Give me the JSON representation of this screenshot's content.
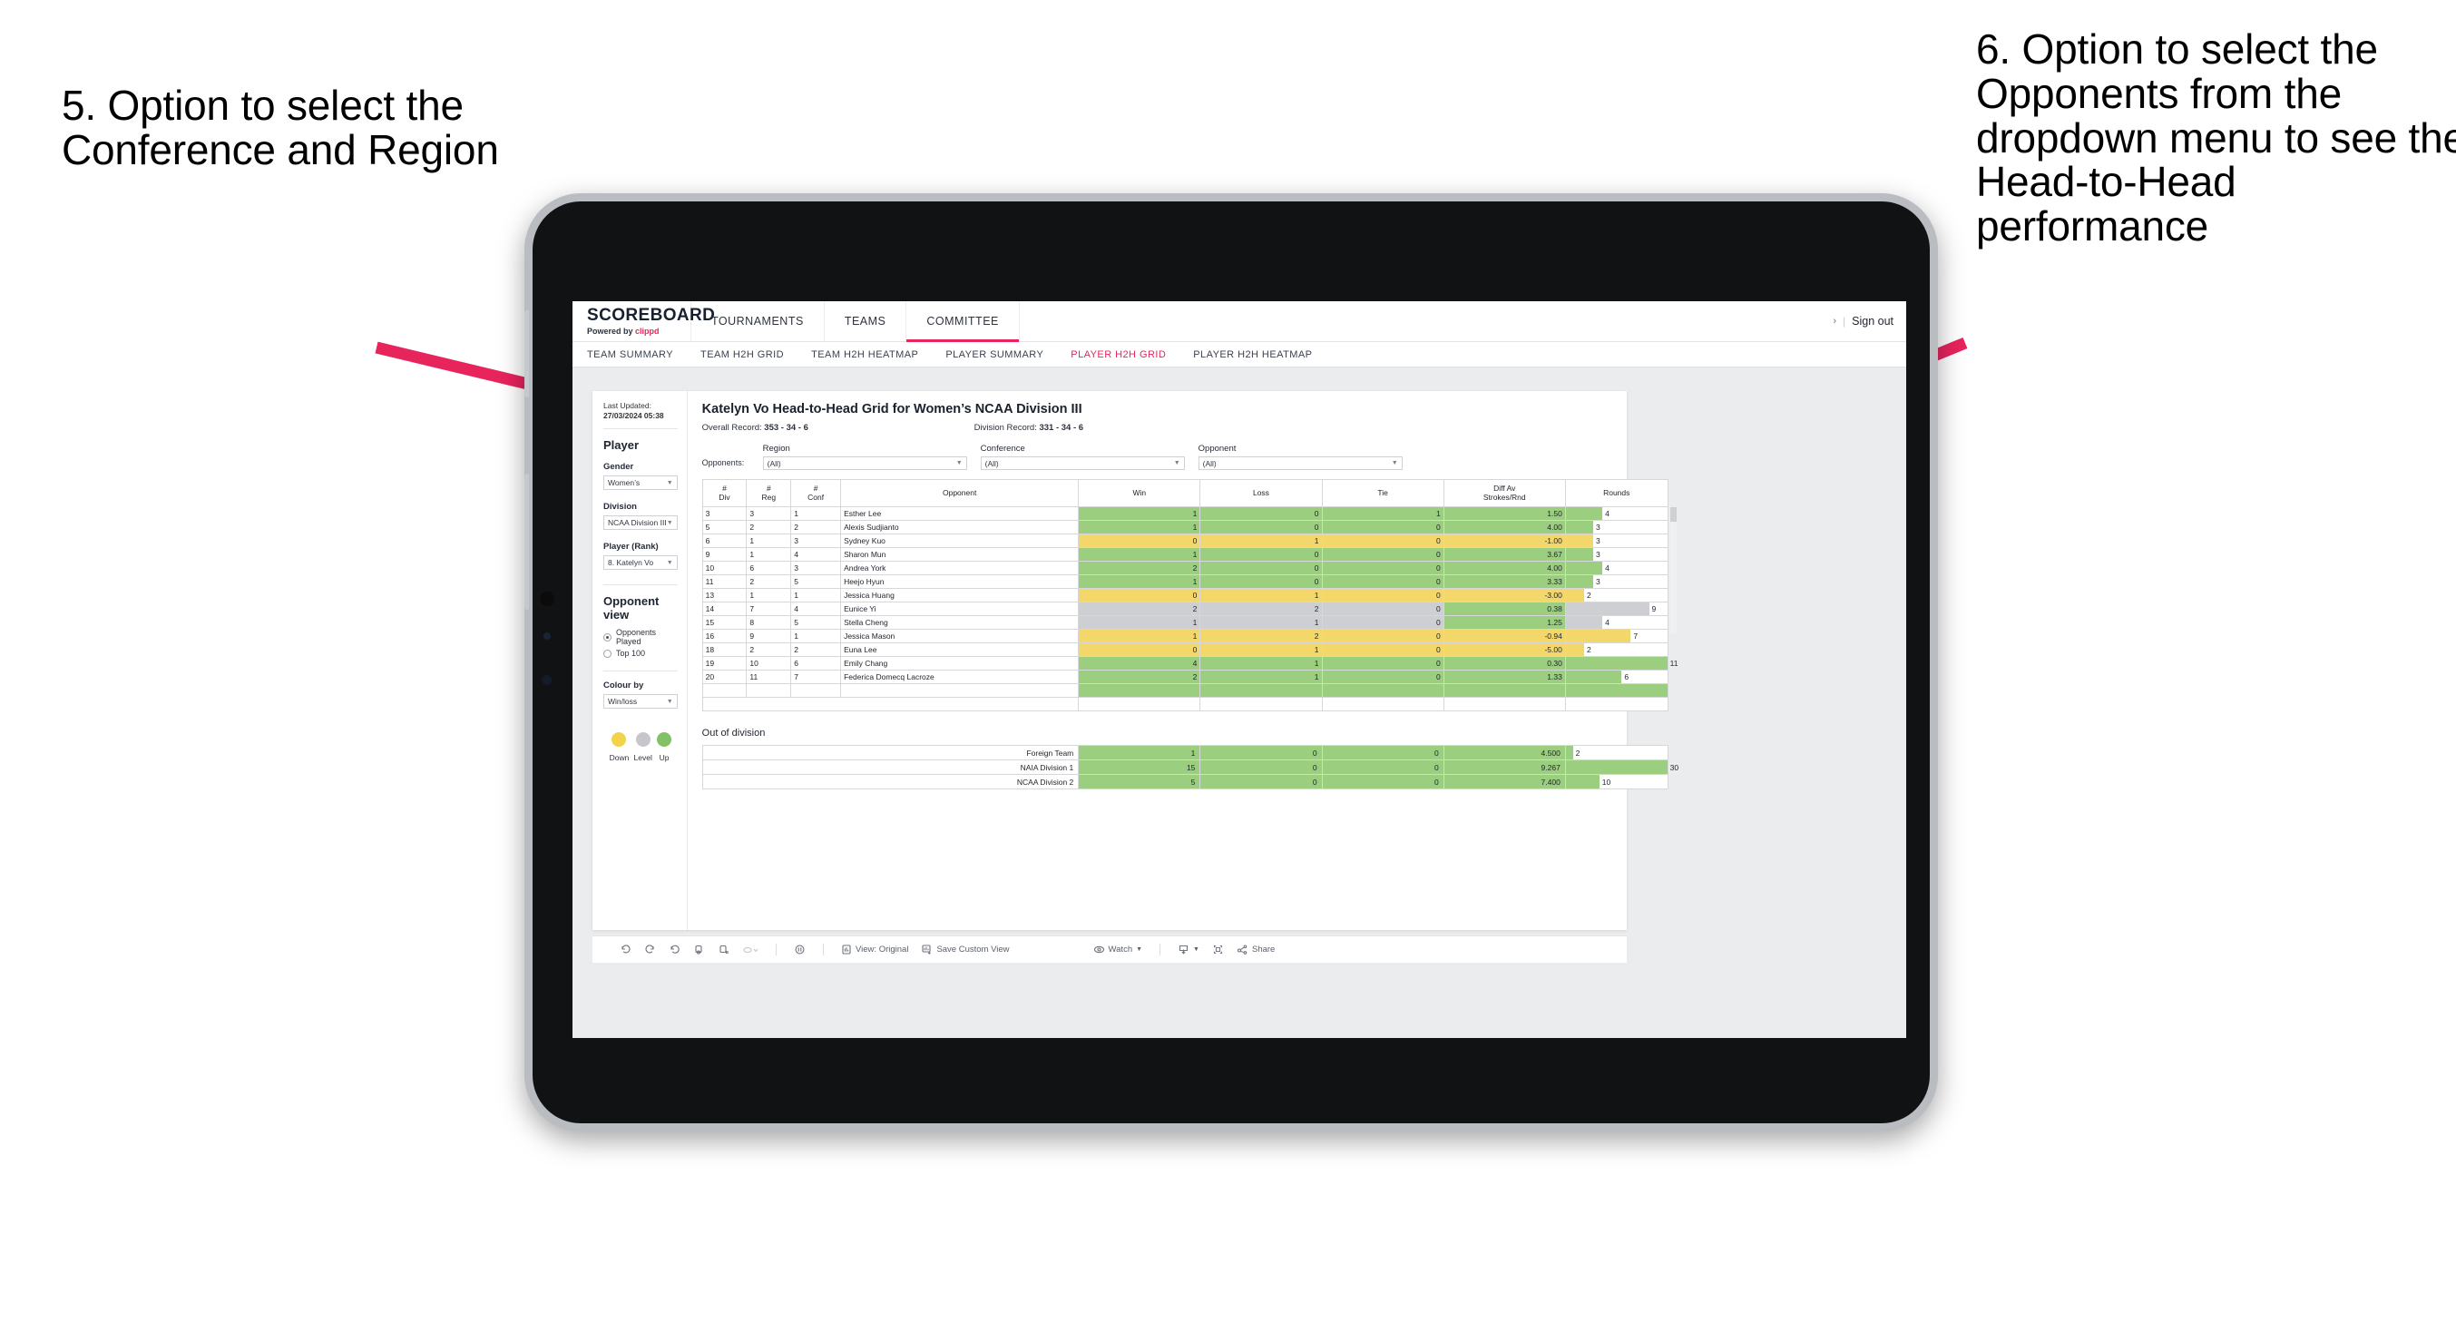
{
  "annotations": {
    "left": "5. Option to select the Conference and Region",
    "right": "6. Option to select the Opponents from the dropdown menu to see the Head-to-Head performance"
  },
  "app": {
    "brand": {
      "title": "SCOREBOARD",
      "powered_prefix": "Powered by ",
      "powered_brand": "clippd"
    },
    "top_nav": [
      {
        "label": "TOURNAMENTS",
        "active": false
      },
      {
        "label": "TEAMS",
        "active": false
      },
      {
        "label": "COMMITTEE",
        "active": true
      }
    ],
    "top_right": {
      "chevron": "›",
      "separator": "|",
      "signout": "Sign out"
    },
    "sub_nav": [
      {
        "label": "TEAM SUMMARY",
        "active": false
      },
      {
        "label": "TEAM H2H GRID",
        "active": false
      },
      {
        "label": "TEAM H2H HEATMAP",
        "active": false
      },
      {
        "label": "PLAYER SUMMARY",
        "active": false
      },
      {
        "label": "PLAYER H2H GRID",
        "active": true
      },
      {
        "label": "PLAYER H2H HEATMAP",
        "active": false
      }
    ]
  },
  "sidebar": {
    "last_updated_label": "Last Updated: ",
    "last_updated_value": "27/03/2024 05:38",
    "player_heading": "Player",
    "gender": {
      "label": "Gender",
      "value": "Women’s"
    },
    "division": {
      "label": "Division",
      "value": "NCAA Division III"
    },
    "player_rank": {
      "label": "Player (Rank)",
      "value": "8. Katelyn Vo"
    },
    "opponent_view": {
      "heading": "Opponent view",
      "options": [
        {
          "label": "Opponents Played",
          "selected": true
        },
        {
          "label": "Top 100",
          "selected": false
        }
      ]
    },
    "colour_by": {
      "label": "Colour by",
      "value": "Win/loss"
    },
    "legend": [
      {
        "label": "Down",
        "color": "#f2d34a"
      },
      {
        "label": "Level",
        "color": "#c5c7ca"
      },
      {
        "label": "Up",
        "color": "#81c268"
      }
    ]
  },
  "main": {
    "title": "Katelyn Vo Head-to-Head Grid for Women’s NCAA Division III",
    "overall_record_label": "Overall Record: ",
    "overall_record_value": "353 - 34 - 6",
    "division_record_label": "Division Record: ",
    "division_record_value": "331 - 34 - 6",
    "opponents_label": "Opponents:",
    "filters": [
      {
        "caption": "Region",
        "value": "(All)"
      },
      {
        "caption": "Conference",
        "value": "(All)"
      },
      {
        "caption": "Opponent",
        "value": "(All)"
      }
    ],
    "columns": [
      "# Div",
      "# Reg",
      "# Conf",
      "Opponent",
      "Win",
      "Loss",
      "Tie",
      "Diff Av Strokes/Rnd",
      "Rounds"
    ],
    "column_lines": [
      [
        "#",
        "Div"
      ],
      [
        "#",
        "Reg"
      ],
      [
        "#",
        "Conf"
      ],
      [
        "Opponent",
        ""
      ],
      [
        "Win",
        ""
      ],
      [
        "Loss",
        ""
      ],
      [
        "Tie",
        ""
      ],
      [
        "Diff Av",
        "Strokes/Rnd"
      ],
      [
        "Rounds",
        ""
      ]
    ],
    "rows": [
      {
        "div": "3",
        "reg": "3",
        "conf": "1",
        "opponent": "Esther Lee",
        "win": "1",
        "loss": "0",
        "tie": "1",
        "diff": "1.50",
        "rounds": "4",
        "color": "#9bce7e",
        "bar_pct": 36
      },
      {
        "div": "5",
        "reg": "2",
        "conf": "2",
        "opponent": "Alexis Sudjianto",
        "win": "1",
        "loss": "0",
        "tie": "0",
        "diff": "4.00",
        "rounds": "3",
        "color": "#9bce7e",
        "bar_pct": 27
      },
      {
        "div": "6",
        "reg": "1",
        "conf": "3",
        "opponent": "Sydney Kuo",
        "win": "0",
        "loss": "1",
        "tie": "0",
        "diff": "-1.00",
        "rounds": "3",
        "color": "#f4d76b",
        "bar_pct": 27
      },
      {
        "div": "9",
        "reg": "1",
        "conf": "4",
        "opponent": "Sharon Mun",
        "win": "1",
        "loss": "0",
        "tie": "0",
        "diff": "3.67",
        "rounds": "3",
        "color": "#9bce7e",
        "bar_pct": 27
      },
      {
        "div": "10",
        "reg": "6",
        "conf": "3",
        "opponent": "Andrea York",
        "win": "2",
        "loss": "0",
        "tie": "0",
        "diff": "4.00",
        "rounds": "4",
        "color": "#9bce7e",
        "bar_pct": 36
      },
      {
        "div": "11",
        "reg": "2",
        "conf": "5",
        "opponent": "Heejo Hyun",
        "win": "1",
        "loss": "0",
        "tie": "0",
        "diff": "3.33",
        "rounds": "3",
        "color": "#9bce7e",
        "bar_pct": 27
      },
      {
        "div": "13",
        "reg": "1",
        "conf": "1",
        "opponent": "Jessica Huang",
        "win": "0",
        "loss": "1",
        "tie": "0",
        "diff": "-3.00",
        "rounds": "2",
        "color": "#f4d76b",
        "bar_pct": 18
      },
      {
        "div": "14",
        "reg": "7",
        "conf": "4",
        "opponent": "Eunice Yi",
        "win": "2",
        "loss": "2",
        "tie": "0",
        "diff": "0.38",
        "rounds": "9",
        "color": "#cdcfd2",
        "bar_pct": 82,
        "diff_color": "#9bce7e"
      },
      {
        "div": "15",
        "reg": "8",
        "conf": "5",
        "opponent": "Stella Cheng",
        "win": "1",
        "loss": "1",
        "tie": "0",
        "diff": "1.25",
        "rounds": "4",
        "color": "#cdcfd2",
        "bar_pct": 36,
        "diff_color": "#9bce7e"
      },
      {
        "div": "16",
        "reg": "9",
        "conf": "1",
        "opponent": "Jessica Mason",
        "win": "1",
        "loss": "2",
        "tie": "0",
        "diff": "-0.94",
        "rounds": "7",
        "color": "#f4d76b",
        "bar_pct": 64
      },
      {
        "div": "18",
        "reg": "2",
        "conf": "2",
        "opponent": "Euna Lee",
        "win": "0",
        "loss": "1",
        "tie": "0",
        "diff": "-5.00",
        "rounds": "2",
        "color": "#f4d76b",
        "bar_pct": 18
      },
      {
        "div": "19",
        "reg": "10",
        "conf": "6",
        "opponent": "Emily Chang",
        "win": "4",
        "loss": "1",
        "tie": "0",
        "diff": "0.30",
        "rounds": "11",
        "color": "#9bce7e",
        "bar_pct": 100
      },
      {
        "div": "20",
        "reg": "11",
        "conf": "7",
        "opponent": "Federica Domecq Lacroze",
        "win": "2",
        "loss": "1",
        "tie": "0",
        "diff": "1.33",
        "rounds": "6",
        "color": "#9bce7e",
        "bar_pct": 55
      }
    ],
    "out_of_division": {
      "title": "Out of division",
      "rows": [
        {
          "name": "Foreign Team",
          "win": "1",
          "loss": "0",
          "tie": "0",
          "diff": "4.500",
          "rounds": "2",
          "color": "#9bce7e",
          "bar_pct": 7
        },
        {
          "name": "NAIA Division 1",
          "win": "15",
          "loss": "0",
          "tie": "0",
          "diff": "9.267",
          "rounds": "30",
          "color": "#9bce7e",
          "bar_pct": 100
        },
        {
          "name": "NCAA Division 2",
          "win": "5",
          "loss": "0",
          "tie": "0",
          "diff": "7.400",
          "rounds": "10",
          "color": "#9bce7e",
          "bar_pct": 33
        }
      ]
    }
  },
  "toolbar": {
    "view_label": "View: Original",
    "save_label": "Save Custom View",
    "watch_label": "Watch",
    "share_label": "Share"
  },
  "colors": {
    "accent": "#e8245d",
    "up": "#9bce7e",
    "down": "#f4d76b",
    "level": "#cdcfd2"
  }
}
